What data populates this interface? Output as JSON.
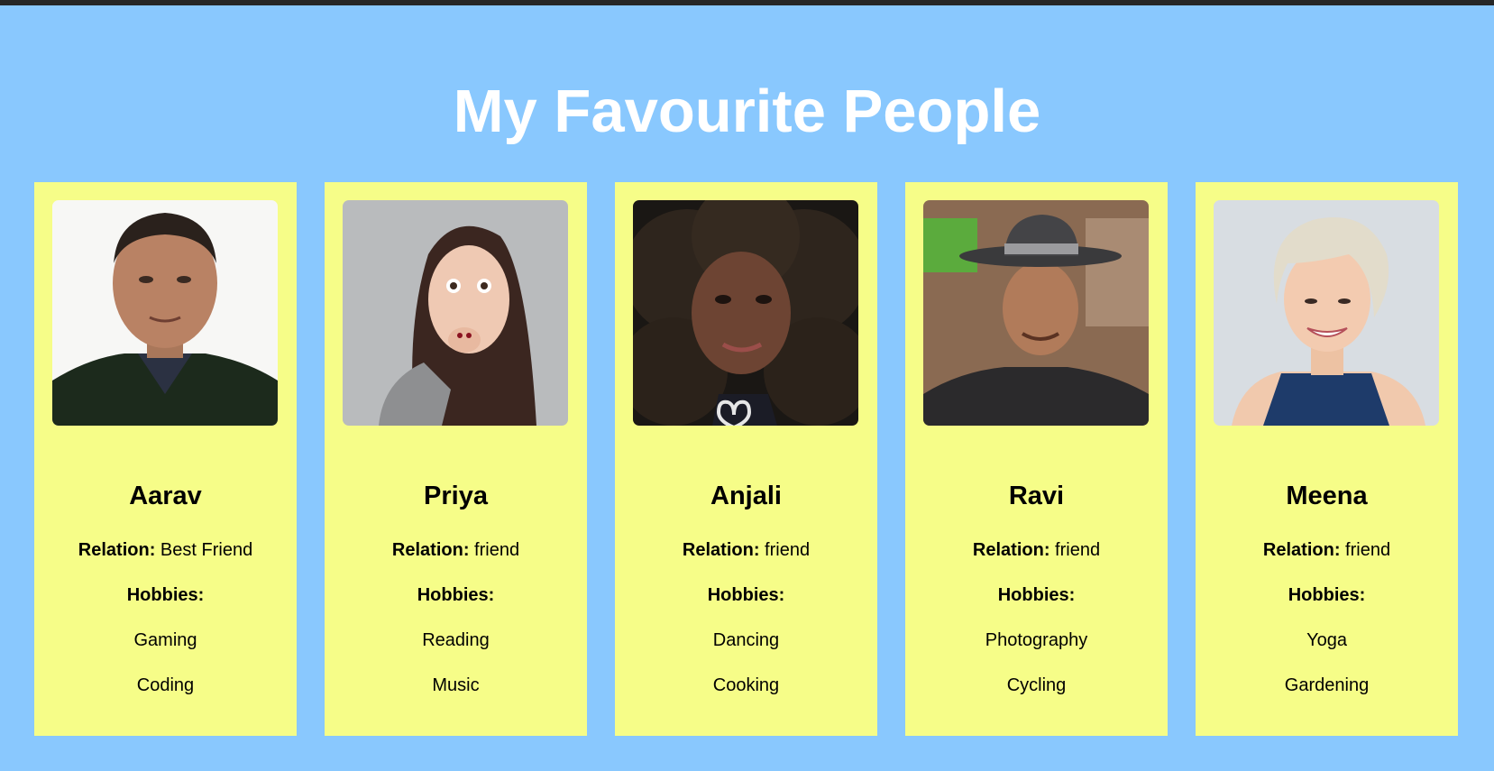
{
  "page": {
    "title": "My Favourite People",
    "background_color": "#89c8fe",
    "card_color": "#f6fd88"
  },
  "labels": {
    "relation": "Relation:",
    "hobbies": "Hobbies:"
  },
  "people": [
    {
      "name": "Aarav",
      "relation": "Best Friend",
      "hobbies": [
        "Gaming",
        "Coding"
      ]
    },
    {
      "name": "Priya",
      "relation": "friend",
      "hobbies": [
        "Reading",
        "Music"
      ]
    },
    {
      "name": "Anjali",
      "relation": "friend",
      "hobbies": [
        "Dancing",
        "Cooking"
      ]
    },
    {
      "name": "Ravi",
      "relation": "friend",
      "hobbies": [
        "Photography",
        "Cycling"
      ]
    },
    {
      "name": "Meena",
      "relation": "friend",
      "hobbies": [
        "Yoga",
        "Gardening"
      ]
    }
  ]
}
